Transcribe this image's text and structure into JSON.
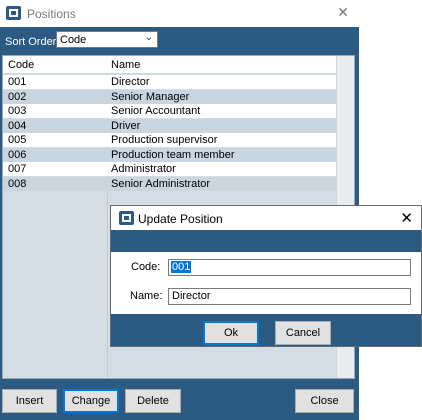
{
  "window": {
    "title": "Positions",
    "icon": "app-icon"
  },
  "toolbar": {
    "sort_label": "Sort Order",
    "sort_value": "Code"
  },
  "grid": {
    "columns": [
      "Code",
      "Name"
    ],
    "rows": [
      {
        "code": "001",
        "name": "Director"
      },
      {
        "code": "002",
        "name": "Senior Manager"
      },
      {
        "code": "003",
        "name": "Senior Accountant"
      },
      {
        "code": "004",
        "name": "Driver"
      },
      {
        "code": "005",
        "name": "Production supervisor"
      },
      {
        "code": "006",
        "name": "Production team member"
      },
      {
        "code": "007",
        "name": "Administrator"
      },
      {
        "code": "008",
        "name": "Senior Administrator"
      }
    ]
  },
  "buttons": {
    "insert": "Insert",
    "change": "Change",
    "delete": "Delete",
    "close": "Close"
  },
  "dialog": {
    "title": "Update Position",
    "code_label": "Code:",
    "code_value": "001",
    "name_label": "Name:",
    "name_value": "Director",
    "ok": "Ok",
    "cancel": "Cancel"
  },
  "colors": {
    "frame": "#2b5b82",
    "grid_row_alt": "#c9d6e0",
    "focus": "#0078d7"
  }
}
